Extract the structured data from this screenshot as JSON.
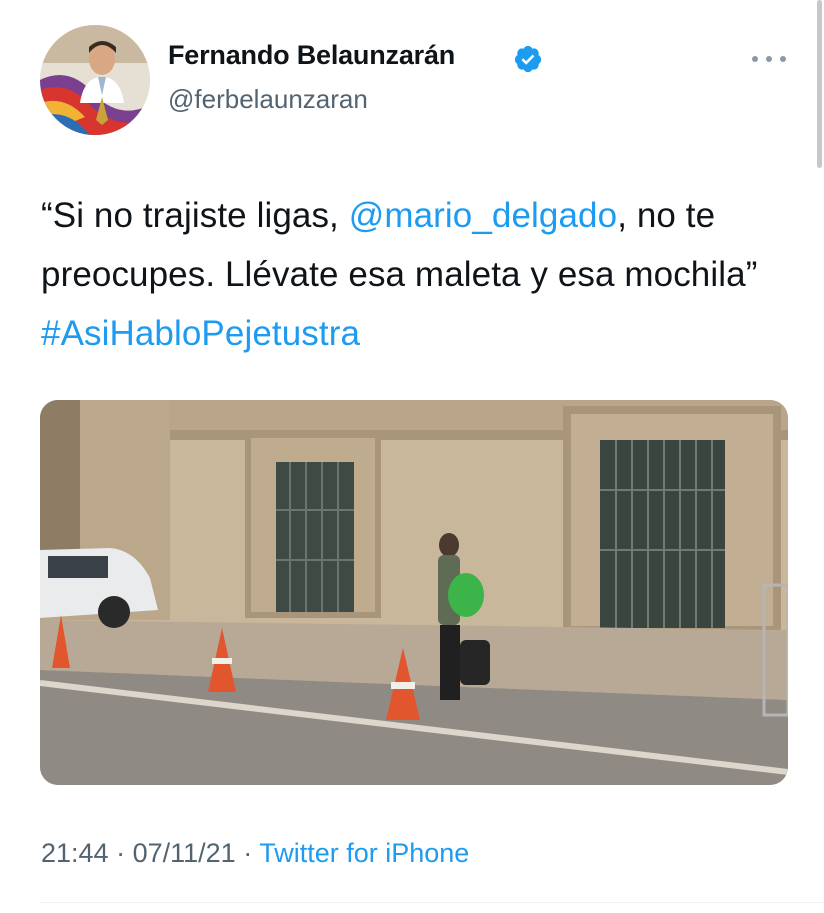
{
  "tweet": {
    "author": {
      "display_name": "Fernando Belaunzarán",
      "username": "@ferbelaunzaran",
      "verified": true,
      "avatar_icon": "profile-photo-avatar"
    },
    "text": {
      "part1": "“Si no trajiste ligas, ",
      "mention": "@mario_delgado",
      "part2": ", no te preocupes. Llévate esa maleta y esa mochila” ",
      "hashtag": "#AsiHabloPejetustra"
    },
    "media": {
      "type": "video-still",
      "icon": "media-image"
    },
    "meta": {
      "time": "21:44",
      "separator": " · ",
      "date": "07/11/21",
      "source": "Twitter for iPhone"
    }
  },
  "colors": {
    "link": "#1d9bf0",
    "secondary_text": "#536471",
    "primary_text": "#0f1419",
    "verified_badge": "#1d9bf0"
  }
}
